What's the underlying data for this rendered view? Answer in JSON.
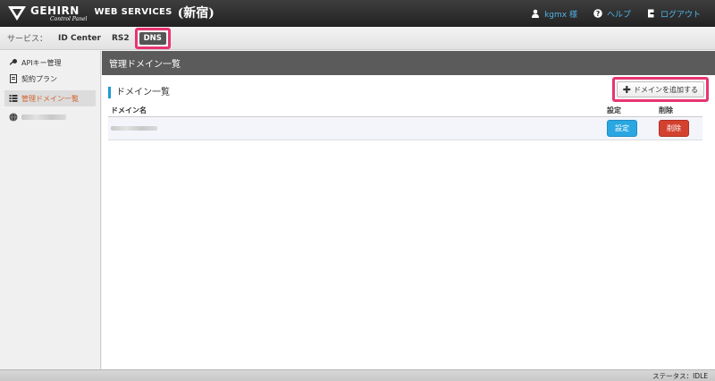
{
  "brand": {
    "name": "GEHIRN",
    "subtitle": "Control Panel",
    "services": "WEB SERVICES",
    "seal": "(新宿)"
  },
  "topnav": {
    "user": "kgmx 様",
    "help": "ヘルプ",
    "logout": "ログアウト"
  },
  "servicebar": {
    "label": "サービス：",
    "items": [
      "ID Center",
      "RS2",
      "DNS"
    ]
  },
  "sidebar": {
    "items": [
      {
        "label": "APIキー管理",
        "icon": "key-icon"
      },
      {
        "label": "契約プラン",
        "icon": "document-icon"
      },
      {
        "label": "管理ドメイン一覧",
        "icon": "list-icon",
        "active": true
      }
    ]
  },
  "main": {
    "header": "管理ドメイン一覧",
    "panel_title": "ドメイン一覧",
    "add_button": "ドメインを追加する",
    "columns": [
      "ドメイン名",
      "設定",
      "削除"
    ],
    "row": {
      "settings_button": "設定",
      "delete_button": "削除"
    }
  },
  "footer": {
    "status": "ステータス：IDLE"
  },
  "colors": {
    "accent": "#1f9ad6",
    "highlight": "#e8356f",
    "active_text": "#d2622d",
    "delete": "#d3412f"
  }
}
